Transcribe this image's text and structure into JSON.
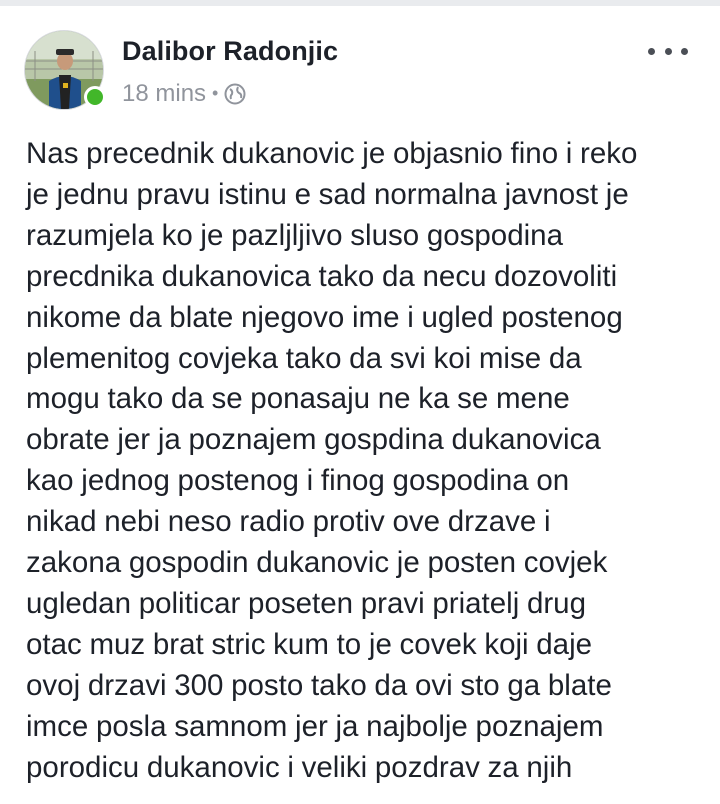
{
  "post": {
    "author": "Dalibor Radonjic",
    "timestamp": "18 mins",
    "separator": "•",
    "privacy_icon": "globe-icon",
    "more_icon": "more-options-icon",
    "online": true,
    "text": "Nas precednik dukanovic je objasnio fino i reko\nje jednu pravu istinu e sad normalna javnost je\nrazumjela ko je pazljljivo sluso gospodina\nprecdnika dukanovica tako da necu dozovoliti\nnikome da blate njegovo ime i ugled postenog\nplemenitog covjeka tako da svi koi mise da\nmogu tako da se ponasaju ne ka se mene\nobrate jer ja poznajem gospdina dukanovica\nkao jednog postenog i finog gospodina on\nnikad nebi neso radio protiv ove drzave i\nzakona gospodin dukanovic je posten covjek\nugledan politicar poseten pravi priatelj drug\notac muz brat stric kum to je covek koji daje\novoj drzavi 300 posto tako da ovi sto ga blate\nimce posla samnom jer ja najbolje poznajem\nporodicu dukanovic i veliki pozdrav za njih"
  },
  "colors": {
    "name": "#1d2129",
    "meta": "#90949c",
    "online": "#42b72a",
    "divider": "#e9ebee"
  }
}
